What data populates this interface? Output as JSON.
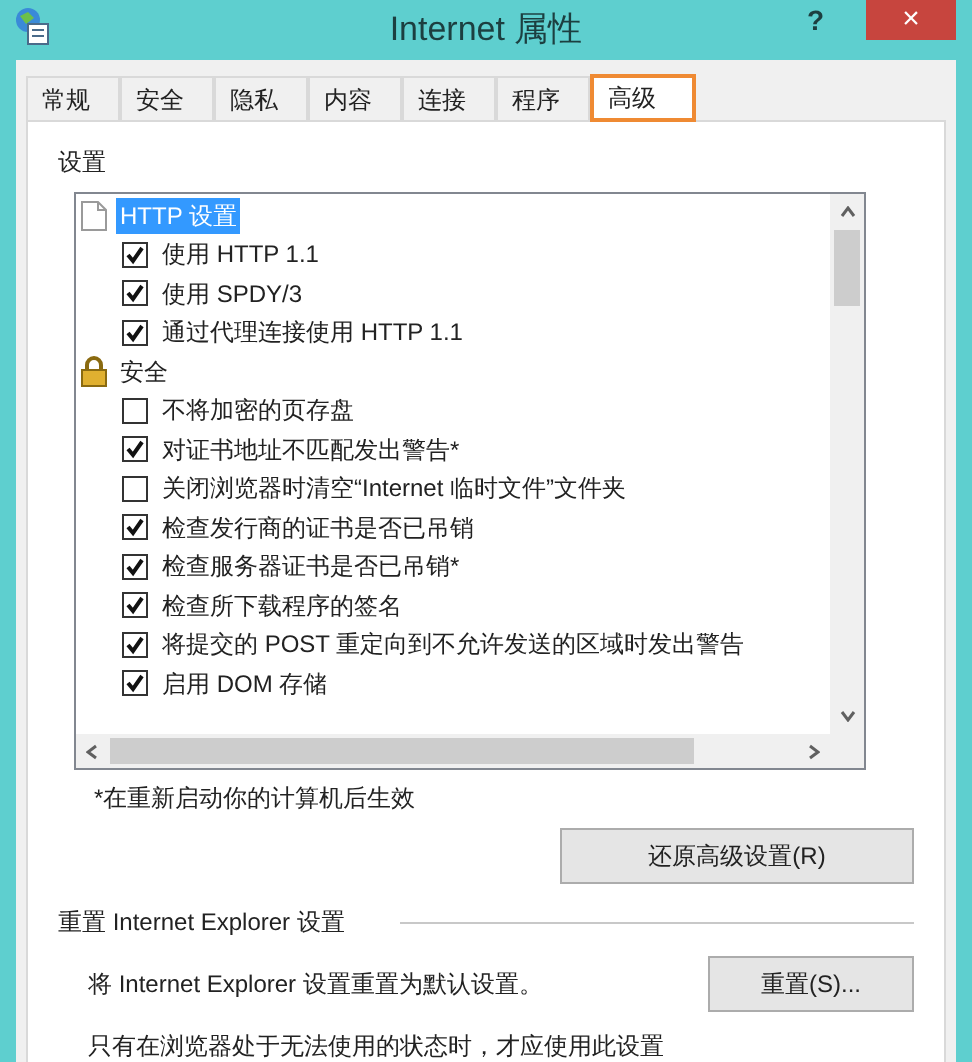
{
  "window": {
    "title": "Internet 属性",
    "help": "?",
    "close": "×"
  },
  "tabs": [
    {
      "label": "常规",
      "selected": false
    },
    {
      "label": "安全",
      "selected": false
    },
    {
      "label": "隐私",
      "selected": false
    },
    {
      "label": "内容",
      "selected": false
    },
    {
      "label": "连接",
      "selected": false
    },
    {
      "label": "程序",
      "selected": false
    },
    {
      "label": "高级",
      "selected": true
    }
  ],
  "settings": {
    "label": "设置",
    "tree": [
      {
        "kind": "page",
        "label": "HTTP 设置",
        "selected": true,
        "children": [
          {
            "kind": "checkbox",
            "label": "使用 HTTP 1.1",
            "checked": true
          },
          {
            "kind": "checkbox",
            "label": "使用 SPDY/3",
            "checked": true
          },
          {
            "kind": "checkbox",
            "label": "通过代理连接使用 HTTP 1.1",
            "checked": true
          }
        ]
      },
      {
        "kind": "lock",
        "label": "安全",
        "selected": false,
        "children": [
          {
            "kind": "checkbox",
            "label": "不将加密的页存盘",
            "checked": false
          },
          {
            "kind": "checkbox",
            "label": "对证书地址不匹配发出警告*",
            "checked": true
          },
          {
            "kind": "checkbox",
            "label": "关闭浏览器时清空“Internet 临时文件”文件夹",
            "checked": false
          },
          {
            "kind": "checkbox",
            "label": "检查发行商的证书是否已吊销",
            "checked": true
          },
          {
            "kind": "checkbox",
            "label": "检查服务器证书是否已吊销*",
            "checked": true
          },
          {
            "kind": "checkbox",
            "label": "检查所下载程序的签名",
            "checked": true
          },
          {
            "kind": "checkbox",
            "label": "将提交的 POST 重定向到不允许发送的区域时发出警告",
            "checked": true
          },
          {
            "kind": "checkbox",
            "label": "启用 DOM 存储",
            "checked": true
          }
        ]
      }
    ],
    "note": "*在重新启动你的计算机后生效",
    "restore_button": "还原高级设置(R)"
  },
  "reset": {
    "title": "重置 Internet Explorer 设置",
    "text": "将 Internet Explorer 设置重置为默认设置。",
    "button": "重置(S)...",
    "note": "只有在浏览器处于无法使用的状态时，才应使用此设置"
  }
}
